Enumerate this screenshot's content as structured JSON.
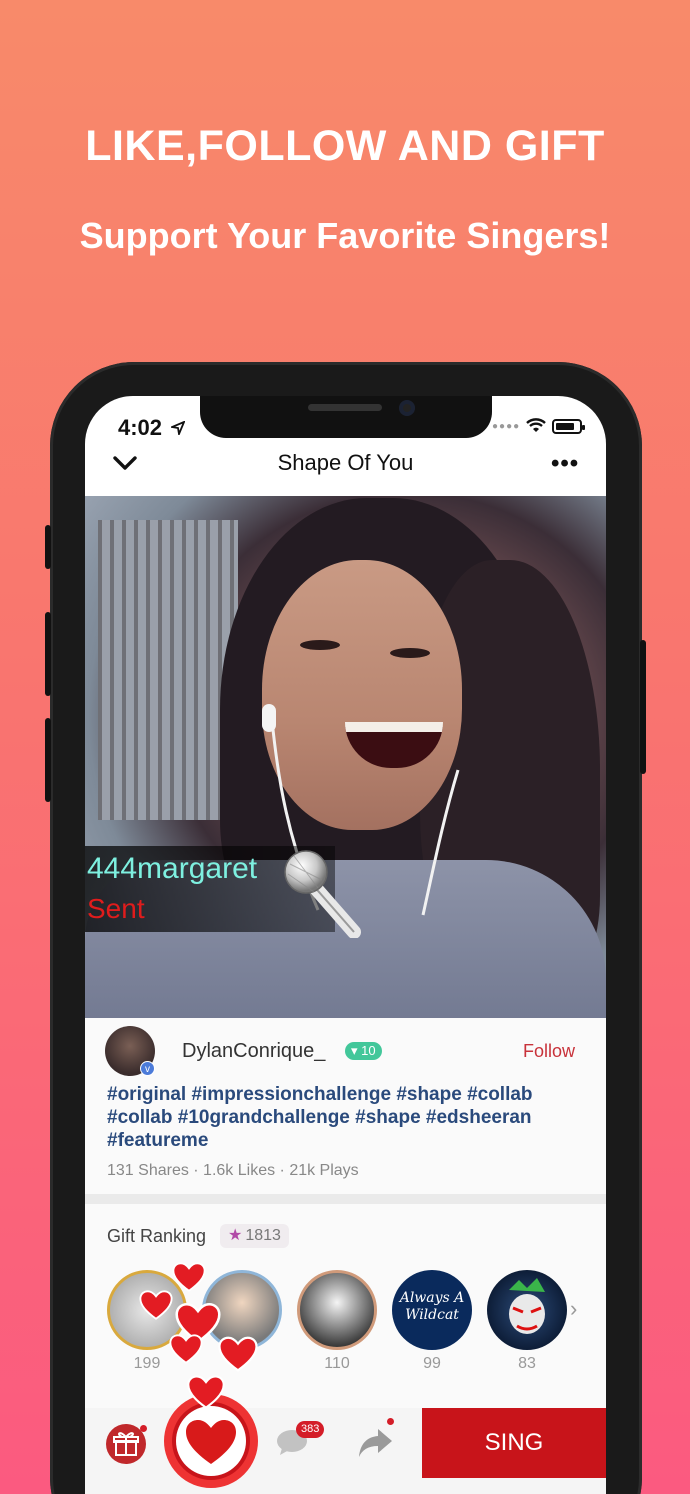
{
  "promo": {
    "headline": "LIKE,FOLLOW AND GIFT",
    "subline": "Support Your Favorite Singers!"
  },
  "status_bar": {
    "time": "4:02"
  },
  "nav": {
    "title": "Shape Of You"
  },
  "gift_notification": {
    "user": "444margaret",
    "action": "Sent"
  },
  "post": {
    "username": "DylanConrique_",
    "level": "10",
    "follow_label": "Follow",
    "hashtags": "#original  #impressionchallenge  #shape  #collab  #collab  #10grandchallenge  #shape  #edsheeran  #featureme",
    "stats": "131 Shares · 1.6k Likes · 21k Plays"
  },
  "gift_ranking": {
    "label": "Gift Ranking",
    "total": "1813",
    "donors": [
      {
        "value": "199"
      },
      {
        "value": ""
      },
      {
        "value": "110"
      },
      {
        "value": "99",
        "logo_text": "Always A Wildcat"
      },
      {
        "value": "83"
      }
    ]
  },
  "bottom_bar": {
    "comment_count": "383",
    "sing_label": "SING"
  },
  "colors": {
    "accent": "#c8141a",
    "follow": "#c8323a",
    "hashtag": "#2a4a7c",
    "level_badge": "#42c79a"
  }
}
